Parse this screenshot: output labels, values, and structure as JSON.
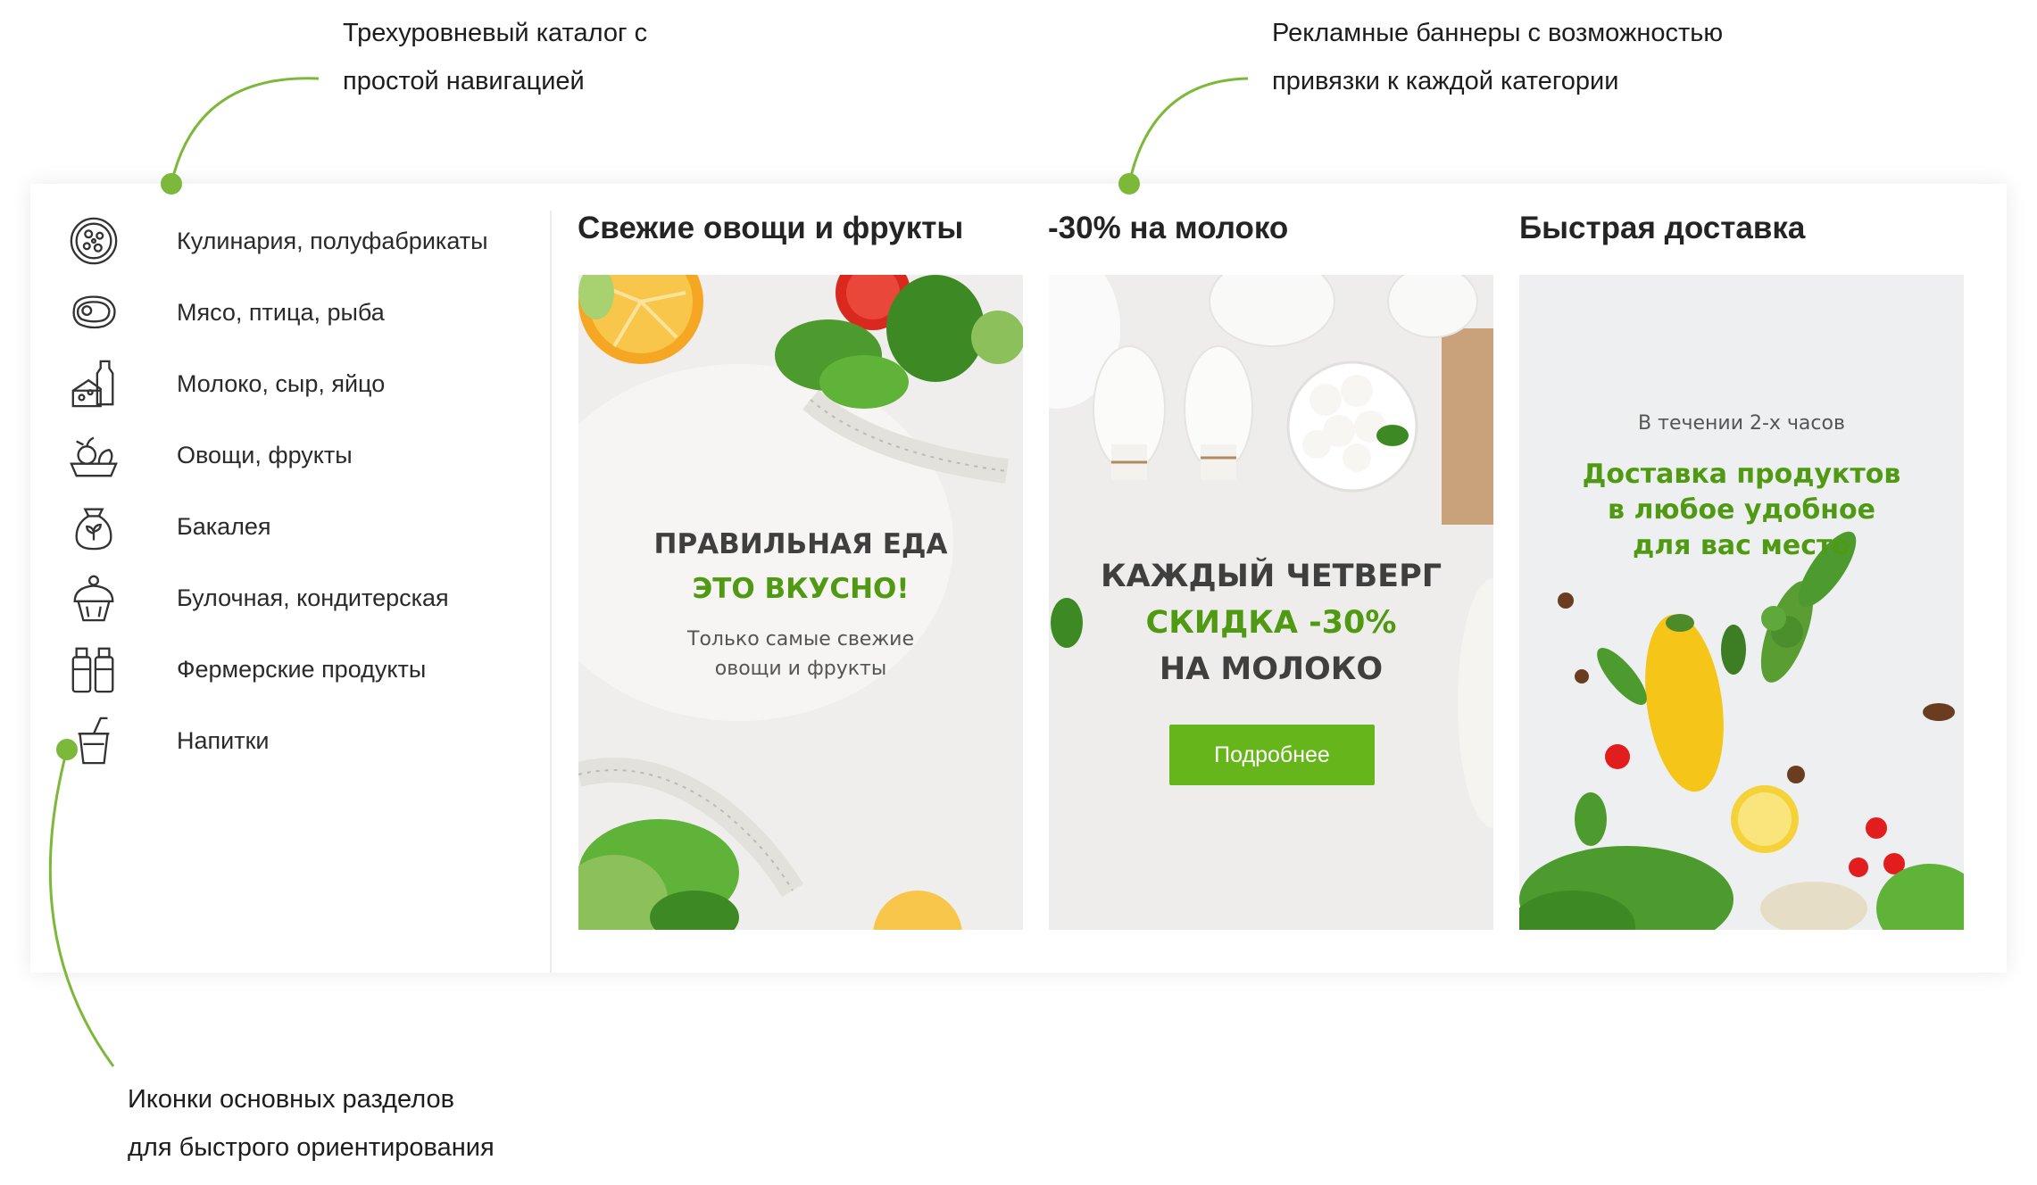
{
  "annotations": {
    "catalog": [
      "Трехуровневый каталог с",
      "простой навигацией"
    ],
    "banners": [
      "Рекламные баннеры с возможностью",
      "привязки к каждой категории"
    ],
    "icons": [
      "Иконки основных разделов",
      "для быстрого ориентирования"
    ]
  },
  "menu": {
    "items": [
      {
        "label": "Кулинария, полуфабрикаты",
        "icon": "pizza-icon"
      },
      {
        "label": "Мясо, птица, рыба",
        "icon": "meat-icon"
      },
      {
        "label": "Молоко, сыр, яйцо",
        "icon": "dairy-icon"
      },
      {
        "label": "Овощи, фрукты",
        "icon": "vegetables-icon"
      },
      {
        "label": "Бакалея",
        "icon": "grocery-sack-icon"
      },
      {
        "label": "Булочная, кондитерская",
        "icon": "cupcake-icon"
      },
      {
        "label": "Фермерские продукты",
        "icon": "farm-bottles-icon"
      },
      {
        "label": "Напитки",
        "icon": "drink-cup-icon"
      }
    ]
  },
  "columns": [
    {
      "title": "Свежие овощи и фрукты"
    },
    {
      "title": "-30% на молоко"
    },
    {
      "title": "Быстрая доставка"
    }
  ],
  "banners": {
    "fresh": {
      "line1": "ПРАВИЛЬНАЯ ЕДА",
      "line2": "ЭТО ВКУСНО!",
      "sub1": "Только самые свежие",
      "sub2": "овощи и фрукты"
    },
    "milk": {
      "line1": "КАЖДЫЙ ЧЕТВЕРГ",
      "line2": "СКИДКА -30%",
      "line3": "НА МОЛОКО",
      "button": "Подробнее"
    },
    "delivery": {
      "small": "В течении 2-х часов",
      "line1": "Доставка продуктов",
      "line2": "в любое удобное",
      "line3": "для вас место"
    }
  },
  "colors": {
    "accent_green": "#66b51a",
    "callout_green": "#7cb83a",
    "heading_dark": "#3f3f3f"
  }
}
